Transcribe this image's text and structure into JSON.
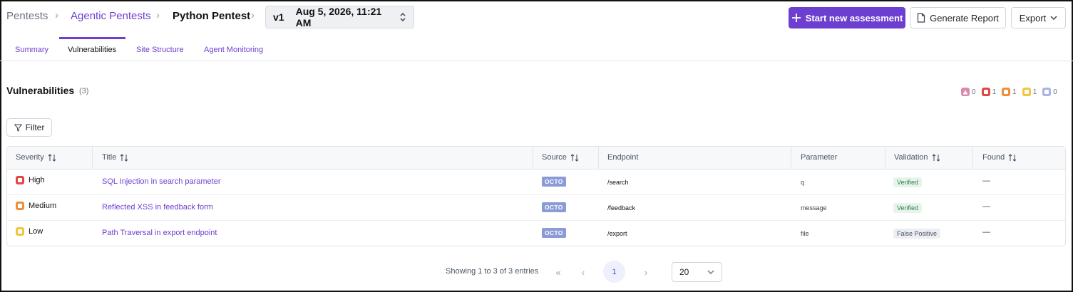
{
  "breadcrumb": {
    "items": [
      "Pentests",
      "Agentic Pentests",
      "Python Pentest"
    ]
  },
  "version_select": {
    "version": "v1",
    "date": "Aug 5, 2026, 11:21 AM"
  },
  "actions": {
    "start": "Start new assessment",
    "report": "Generate Report",
    "export": "Export"
  },
  "tabs": [
    {
      "label": "Summary",
      "active": false
    },
    {
      "label": "Vulnerabilities",
      "active": true
    },
    {
      "label": "Site Structure",
      "active": false
    },
    {
      "label": "Agent Monitoring",
      "active": false
    }
  ],
  "section": {
    "title": "Vulnerabilities",
    "count": "(3)",
    "severity_counts": [
      {
        "level": "critical",
        "icon": "triangle-icon",
        "color": "#d98bb0",
        "count": "0"
      },
      {
        "level": "high",
        "icon": "square-icon",
        "color": "#e04848",
        "count": "1"
      },
      {
        "level": "medium",
        "icon": "square-icon",
        "color": "#ef8f3e",
        "count": "1"
      },
      {
        "level": "low",
        "icon": "square-icon",
        "color": "#f2c53d",
        "count": "1"
      },
      {
        "level": "info",
        "icon": "square-icon",
        "color": "#a9b3e6",
        "count": "0"
      }
    ]
  },
  "filter": {
    "label": "Filter"
  },
  "table": {
    "headers": {
      "severity": "Severity",
      "title": "Title",
      "source": "Source",
      "endpoint": "Endpoint",
      "parameter": "Parameter",
      "validation": "Validation",
      "found": "Found"
    },
    "rows": [
      {
        "severity": "High",
        "severity_color": "#e04848",
        "title": "SQL Injection in search parameter",
        "source": "OCTO",
        "endpoint": "/search",
        "parameter": "q",
        "validation": "Verified",
        "found": "—"
      },
      {
        "severity": "Medium",
        "severity_color": "#ef8f3e",
        "title": "Reflected XSS in feedback form",
        "source": "OCTO",
        "endpoint": "/feedback",
        "parameter": "message",
        "validation": "Verified",
        "found": "—"
      },
      {
        "severity": "Low",
        "severity_color": "#f2c53d",
        "title": "Path Traversal in export endpoint",
        "source": "OCTO",
        "endpoint": "/export",
        "parameter": "file",
        "validation": "False Positive",
        "found": "—"
      }
    ]
  },
  "pagination": {
    "info": "Showing 1 to 3 of 3 entries",
    "current_page": "1",
    "page_size": "20"
  },
  "colors": {
    "accent": "#6d3fd0",
    "verified_bg": "#e6f4ea",
    "verified_fg": "#2e7d4f",
    "false_positive_bg": "#eceef1",
    "false_positive_fg": "#4b5563"
  }
}
